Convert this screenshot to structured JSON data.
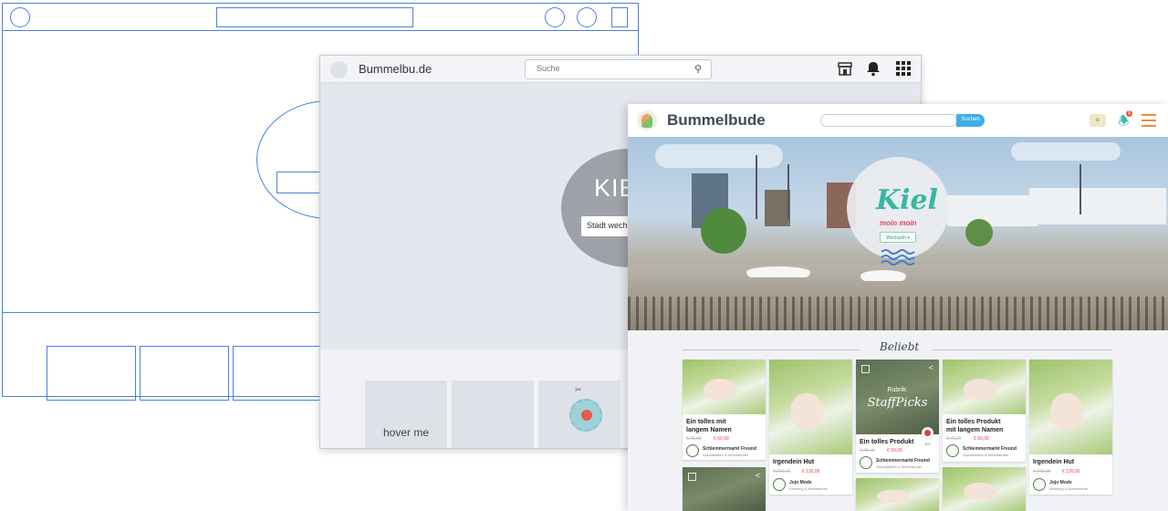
{
  "mid": {
    "brand": "Bummelbu.de",
    "search_placeholder": "Suche",
    "hero_city": "KIE",
    "hero_button": "Stadt wechse",
    "tile_label": "hover me"
  },
  "front": {
    "brand": "Bummelbude",
    "search_button": "Suchen",
    "notification_count": "1",
    "hero_city": "Kiel",
    "hero_tagline": "moin moin",
    "hero_button": "Wechseln ▾",
    "section_title": "Beliebt",
    "cards": [
      {
        "title1": "Ein tolles mit",
        "title2": "langem Namen",
        "old": "€ 75,00",
        "new": "€ 60,00",
        "shop": "Schlemmermarkt Freund",
        "cat": "Spezialitäten & Weinhändler"
      },
      {
        "title1": "Irgendein Hut",
        "old": "€ 200,00",
        "new": "€ 120,00",
        "shop": "Jojo Mode",
        "cat": "Kleidung & Accessoires"
      },
      {
        "rubrik_label": "Rubrik:",
        "rubrik_name": "StaffPicks",
        "title1": "Ein tolles Produkt",
        "likes": "102",
        "old": "€ 75,00",
        "new": "€ 60,00",
        "shop": "Schlemmermarkt Freund",
        "cat": "Spezialitäten & Weinhändler"
      },
      {
        "title1": "Ein tolles Produkt",
        "title2": "mit langem Namen",
        "old": "€ 75,00",
        "new": "€ 60,00",
        "shop": "Schlemmermarkt Freund",
        "cat": "Spezialitäten & Weinhändler"
      },
      {
        "title1": "Irgendein Hut",
        "old": "€ 200,00",
        "new": "€ 120,00",
        "shop": "Jojo Mode",
        "cat": "Kleidung & Accessoires"
      }
    ]
  }
}
